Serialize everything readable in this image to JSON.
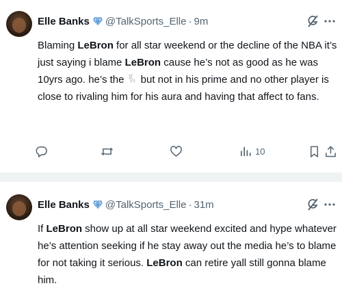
{
  "colors": {
    "text": "#0f1419",
    "muted": "#536471",
    "verified": "#5b9bd5",
    "separator": "#eff3f4"
  },
  "tweets": [
    {
      "author_name": "Elle Banks",
      "handle": "@TalkSports_Elle",
      "separator": "·",
      "time": "9m",
      "text": {
        "p1": "Blaming ",
        "b1": "LeBron",
        "p2": " for all star weekend or the decline of the NBA it’s just saying i blame ",
        "b2": "LeBron",
        "p3": " cause he’s not as good as he was 10yrs ago. he’s the ",
        "emoji": "goat",
        "p4": "but not in his prime and no other player is close to rivaling him for his aura and having that affect to fans."
      },
      "actions": {
        "reply": "",
        "retweet": "",
        "like": "",
        "views": "10"
      }
    },
    {
      "author_name": "Elle Banks",
      "handle": "@TalkSports_Elle",
      "separator": "·",
      "time": "31m",
      "text": {
        "p1": "If ",
        "b1": "LeBron",
        "p2": " show up at all star weekend excited and hype whatever he’s attention seeking if he stay away out the media he’s to blame for not taking it serious. ",
        "b2": "LeBron",
        "p3": " can retire yall still gonna blame him."
      }
    }
  ],
  "icons": [
    "verified-badge-icon",
    "grok-icon",
    "more-icon",
    "reply-icon",
    "retweet-icon",
    "like-icon",
    "views-icon",
    "bookmark-icon",
    "share-icon",
    "goat-emoji"
  ]
}
